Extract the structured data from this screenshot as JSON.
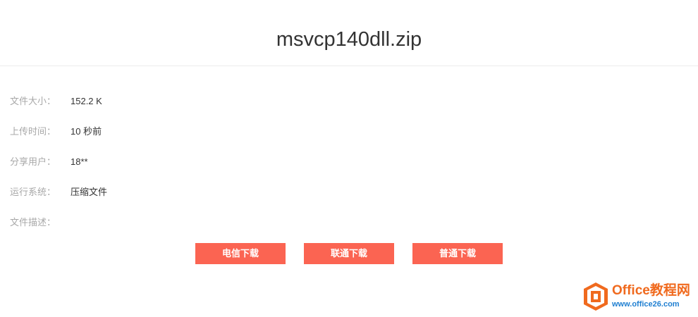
{
  "file": {
    "name": "msvcp140dll.zip"
  },
  "info": [
    {
      "label": "文件大小：",
      "value": "152.2 K"
    },
    {
      "label": "上传时间：",
      "value": "10 秒前"
    },
    {
      "label": "分享用户：",
      "value": "18**"
    },
    {
      "label": "运行系统：",
      "value": "压缩文件"
    },
    {
      "label": "文件描述：",
      "value": ""
    }
  ],
  "buttons": {
    "telecom": "电信下载",
    "unicom": "联通下载",
    "normal": "普通下载"
  },
  "watermark": {
    "name": "Office教程网",
    "url": "www.office26.com",
    "icon": "office-logo-icon"
  },
  "colors": {
    "button": "#fb6452",
    "watermark_orange": "#f06a1e",
    "watermark_blue": "#1f7fd1"
  }
}
